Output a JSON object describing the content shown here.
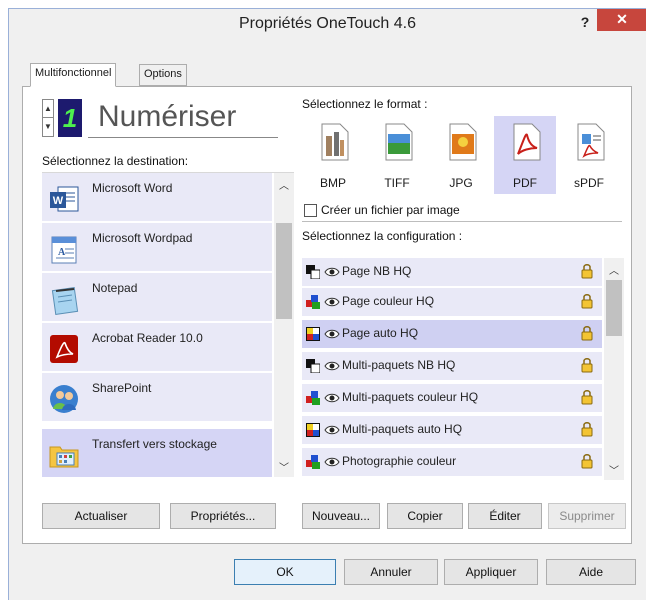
{
  "window": {
    "title": "Propriétés OneTouch 4.6",
    "help_label": "?",
    "close_label": "✕"
  },
  "tabs": [
    {
      "label": "Multifonctionnel",
      "active": true
    },
    {
      "label": "Options",
      "active": false
    }
  ],
  "action": {
    "number": "1",
    "name": "Numériser"
  },
  "destination": {
    "label": "Sélectionnez la destination:",
    "items": [
      {
        "label": "Microsoft Word",
        "icon": "microsoft-word-icon",
        "selected": false
      },
      {
        "label": "Microsoft Wordpad",
        "icon": "wordpad-icon",
        "selected": false
      },
      {
        "label": "Notepad",
        "icon": "notepad-icon",
        "selected": false
      },
      {
        "label": "Acrobat Reader 10.0",
        "icon": "acrobat-reader-icon",
        "selected": false
      },
      {
        "label": "SharePoint",
        "icon": "sharepoint-icon",
        "selected": false
      },
      {
        "label": "Transfert vers stockage",
        "icon": "storage-folder-icon",
        "selected": true
      }
    ]
  },
  "format": {
    "label": "Sélectionnez le format :",
    "items": [
      {
        "label": "BMP",
        "icon": "bmp-format-icon",
        "selected": false
      },
      {
        "label": "TIFF",
        "icon": "tiff-format-icon",
        "selected": false
      },
      {
        "label": "JPG",
        "icon": "jpg-format-icon",
        "selected": false
      },
      {
        "label": "PDF",
        "icon": "pdf-format-icon",
        "selected": true
      },
      {
        "label": "sPDF",
        "icon": "spdf-format-icon",
        "selected": false
      }
    ],
    "checkbox_label": "Créer un fichier par image",
    "checkbox_checked": false
  },
  "configuration": {
    "label": "Sélectionnez la configuration :",
    "items": [
      {
        "label": "Page NB HQ",
        "icon": "bw-page-icon",
        "selected": false
      },
      {
        "label": "Page couleur HQ",
        "icon": "color-page-icon",
        "selected": false
      },
      {
        "label": "Page auto HQ",
        "icon": "auto-page-icon",
        "selected": true
      },
      {
        "label": "Multi-paquets NB HQ",
        "icon": "bw-page-icon",
        "selected": false
      },
      {
        "label": "Multi-paquets couleur HQ",
        "icon": "color-page-icon",
        "selected": false
      },
      {
        "label": "Multi-paquets auto HQ",
        "icon": "auto-page-icon",
        "selected": false
      },
      {
        "label": "Photographie couleur",
        "icon": "color-page-icon",
        "selected": false
      }
    ]
  },
  "buttons": {
    "refresh": "Actualiser",
    "properties": "Propriétés...",
    "new": "Nouveau...",
    "copy": "Copier",
    "edit": "Éditer",
    "delete": "Supprimer",
    "ok": "OK",
    "cancel": "Annuler",
    "apply": "Appliquer",
    "help": "Aide"
  },
  "colors": {
    "selection": "#d5d5f5",
    "list_background": "#e9e9f7",
    "close_button": "#c7463d",
    "digit_background": "#1d1a6e",
    "digit_color": "#4ef04e"
  }
}
